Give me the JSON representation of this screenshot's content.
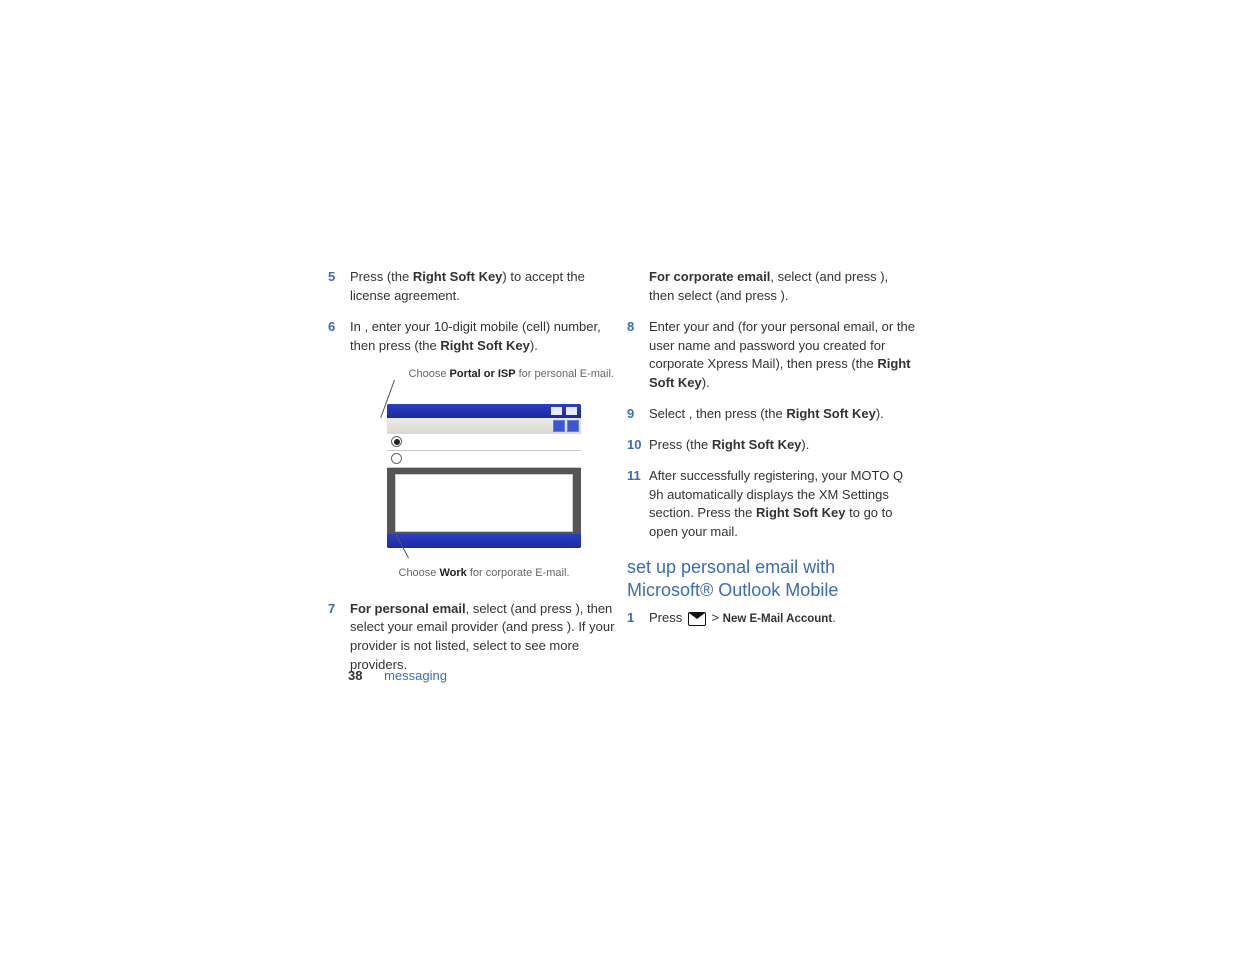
{
  "left": {
    "step5": {
      "num": "5",
      "t1": "Press ",
      "b1": "Right Soft Key",
      "t2": " (the ",
      "t3": ") to accept the license agreement."
    },
    "step6": {
      "num": "6",
      "t1": "In ",
      "t2": ", enter your 10-digit mobile (cell) number, then press ",
      "t3": " (the ",
      "b1": "Right Soft Key",
      "t4": ")."
    },
    "labelTop": {
      "t1": "Choose ",
      "b1": "Portal or ISP",
      "t2": " for personal E-mail."
    },
    "labelBottom": {
      "t1": "Choose ",
      "b1": "Work",
      "t2": " for corporate E-mail."
    },
    "step7": {
      "num": "7",
      "b0": "For personal email",
      "t1": ", select ",
      "t2": " (and press ",
      "t3": "), then select your email provider (and press ",
      "t4": "). If your provider is not listed, select ",
      "t5": " to see more providers."
    }
  },
  "right": {
    "cont7": {
      "b0": "For corporate email",
      "t1": ", select ",
      "t2": " (and press ",
      "t3": "), then select ",
      "t4": " (and press ",
      "t5": ")."
    },
    "step8": {
      "num": "8",
      "t1": "Enter your ",
      "t2": " and ",
      "t3": " (for your personal email, or the user name and password you created for corporate Xpress Mail), then press ",
      "t4": " (the ",
      "b1": "Right Soft Key",
      "t5": ")."
    },
    "step9": {
      "num": "9",
      "t1": "Select ",
      "t2": ", then press ",
      "t3": " (the ",
      "b1": "Right Soft Key",
      "t4": ")."
    },
    "step10": {
      "num": "10",
      "t1": "Press ",
      "t2": " (the ",
      "b1": "Right Soft Key",
      "t3": ")."
    },
    "step11": {
      "num": "11",
      "t1": "After successfully registering, your MOTO Q 9h automatically displays the XM Settings section. Press the ",
      "b1": "Right Soft Key",
      "t2": " to go to open your mail."
    },
    "heading": "set up personal email with Microsoft® Outlook Mobile",
    "step1": {
      "num": "1",
      "t1": "Press ",
      "gt": " > ",
      "path": "New E-Mail Account",
      "t2": "."
    }
  },
  "footer": {
    "page": "38",
    "section": "messaging"
  }
}
